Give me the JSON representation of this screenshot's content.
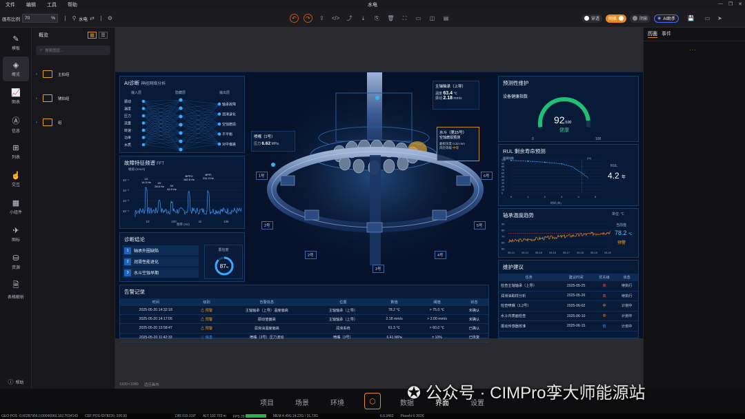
{
  "menu": {
    "items": [
      "文件",
      "编辑",
      "工具",
      "帮助"
    ],
    "window_title": "水电"
  },
  "toolbar": {
    "canvas_ratio_label": "画布比例",
    "zoom_value": "70",
    "zoom_unit": "%",
    "scene_name": "水电",
    "toggles": [
      {
        "label": "穿透",
        "state": "off"
      },
      {
        "label": "网格",
        "state": "on"
      },
      {
        "label": "阴影",
        "state": "off"
      }
    ],
    "ai_label": "AI助手"
  },
  "iconbar": [
    {
      "label": "模板",
      "icon": "template-icon"
    },
    {
      "label": "概览",
      "icon": "layers-icon",
      "active": true
    },
    {
      "label": "图表",
      "icon": "chart-icon"
    },
    {
      "label": "信息",
      "icon": "info-icon"
    },
    {
      "label": "列表",
      "icon": "table-icon"
    },
    {
      "label": "交互",
      "icon": "interact-icon"
    },
    {
      "label": "小组件",
      "icon": "widget-icon"
    },
    {
      "label": "图标",
      "icon": "plane-icon"
    },
    {
      "label": "资源",
      "icon": "resource-icon"
    },
    {
      "label": "表格解析",
      "icon": "file-icon"
    }
  ],
  "help_label": "帮助",
  "tree": {
    "title": "概览",
    "search_placeholder": "搜索图层...",
    "items": [
      "主拍组",
      "辅拍组",
      "组"
    ]
  },
  "dashboard": {
    "ai": {
      "title": "AI诊断",
      "subtitle": "神经网络分析",
      "col_headers": [
        "输入层",
        "隐藏层",
        "输出层"
      ],
      "inputs": [
        "振动",
        "温度",
        "压力",
        "流量",
        "转速",
        "功率",
        "水质"
      ],
      "outputs": [
        "轴承故障",
        "润滑退化",
        "空蚀磨损",
        "不平衡",
        "对中偏差"
      ]
    },
    "fft": {
      "title": "故障特征频谱",
      "subtitle": "FFT",
      "ylabel": "幅值 (mm/s)",
      "xlabel": "频率 (Hz)",
      "peaks": [
        "1X\n14.3 Hz",
        "2X\n28.6 Hz",
        "3X\n42.9 Hz",
        "BPFO\n162.5 Hz",
        "BPFI\n211.3 Hz"
      ],
      "xticks": [
        "10",
        "100",
        "1k",
        "10k"
      ],
      "yticks": [
        "10⁻¹",
        "10⁻²",
        "10⁻³",
        "10⁻⁴"
      ]
    },
    "conclusion": {
      "title": "诊断结论",
      "items": [
        "轴承外圈缺陷",
        "润滑性能退化",
        "水斗空蚀早期"
      ],
      "confidence_label": "置信度",
      "confidence_value": "87",
      "confidence_unit": "%",
      "confidence_fraction": 0.87
    },
    "callouts": {
      "bearing": {
        "title": "主轴轴承（上导）",
        "temp_label": "温度",
        "temp": "63.4",
        "temp_unit": "℃",
        "vib_label": "振动",
        "vib": "2.18",
        "vib_unit": "mm/s"
      },
      "nozzle": {
        "title": "喷嘴（1号）",
        "p_label": "压力",
        "p": "6.62",
        "p_unit": "MPa"
      },
      "bucket": {
        "title": "水斗（第15号）",
        "sub": "空蚀磨损预测",
        "depth_label": "磨损深度",
        "depth": "0.32 mm",
        "risk_label": "风险等级",
        "risk": "中等"
      }
    },
    "nozzle_labels": [
      "1号",
      "2号",
      "3号",
      "4号",
      "5号",
      "6号",
      "2号"
    ],
    "predict": {
      "title": "预测性维护",
      "health_title": "设备健康指数",
      "health_value": "92",
      "health_max": "/100",
      "health_status": "健康",
      "gauge_min": "0",
      "gauge_max": "100",
      "rul_title": "RUL 剩余寿命预测",
      "rul_ylabel": "健康指数",
      "rul_xlabel": "时间 (年)",
      "rul_tag": "RUL",
      "rul_value": "4.2",
      "rul_unit": "年",
      "rul_xticks": [
        "0",
        "1",
        "2",
        "3",
        "4",
        "5"
      ],
      "rul_yticks": [
        "100",
        "90",
        "80",
        "70",
        "60",
        "50",
        "40",
        "30",
        "20",
        "10",
        "0"
      ],
      "rul_y_upper": "(%)"
    },
    "temp_trend": {
      "title": "轴承温度趋势",
      "unit_label": "单位: ℃",
      "current_label": "当前值",
      "current": "78.2",
      "current_unit": "℃",
      "status": "预警",
      "xticks": [
        "05-13",
        "05-14",
        "05-15",
        "05-16",
        "05-17",
        "05-18",
        "05-19",
        "05-20"
      ],
      "yticks": [
        "90",
        "80",
        "70",
        "60",
        "50"
      ]
    },
    "maint": {
      "title": "维护建议",
      "headers": [
        "任务",
        "建议时间",
        "优先级",
        "状态"
      ],
      "rows": [
        [
          "检查主轴轴承（上导）",
          "2025-05-25",
          "高",
          "待执行"
        ],
        [
          "润滑油取样分析",
          "2025-05-26",
          "高",
          "待执行"
        ],
        [
          "检查喷嘴（1,2号）",
          "2025-06-02",
          "中",
          "计划中"
        ],
        [
          "水斗内表面检查",
          "2025-06-10",
          "中",
          "计划中"
        ],
        [
          "振动传感器校准",
          "2025-06-15",
          "低",
          "计划中"
        ]
      ],
      "priority_colors": {
        "高": "#ff4a4a",
        "中": "#f0a020",
        "低": "#3aa0ff"
      }
    },
    "alarms": {
      "title": "告警记录",
      "headers": [
        "时间",
        "级别",
        "告警信息",
        "位置",
        "数值",
        "阈值",
        "状态"
      ],
      "rows": [
        [
          "2025-05-20 14:32:18",
          "预警",
          "主轴轴承（上导）温度偏高",
          "主轴轴承（上导）",
          "78.2 ℃",
          "> 75.0 ℃",
          "未确认"
        ],
        [
          "2025-05-20 14:17:05",
          "预警",
          "振动值偏高",
          "主轴轴承（上导）",
          "2.18 mm/s",
          "> 2.00 mm/s",
          "未确认"
        ],
        [
          "2025-05-20 13:58:47",
          "预警",
          "润滑油温度偏高",
          "润滑系统",
          "61.3 ℃",
          "> 60.0 ℃",
          "已确认"
        ],
        [
          "2025-05-20 11:42:33",
          "信息",
          "喷嘴（3号）压力波动",
          "喷嘴（3号）",
          "6.41 MPa",
          "± 10%",
          "已恢复"
        ]
      ]
    }
  },
  "right_panel": {
    "tabs": [
      "历面",
      "事件"
    ]
  },
  "canvas_size_label": "1920×1080",
  "fit_label": "适应画布",
  "nav": [
    "项目",
    "场景",
    "环境",
    "数据",
    "界面",
    "设置"
  ],
  "watermark": "公众号 · CIMPro孪大师能源站",
  "status": [
    "GEO POS -0.00287956,0.00046069,102.7034143",
    "CEF POS 6378239,-320.50",
    "DIR 010.319°",
    "ALT 102.703 m",
    "FPS 29",
    "MEM 4.49G 24.22G / 31.73G",
    "6.6.3462",
    "Plaoshi © 2026"
  ]
}
